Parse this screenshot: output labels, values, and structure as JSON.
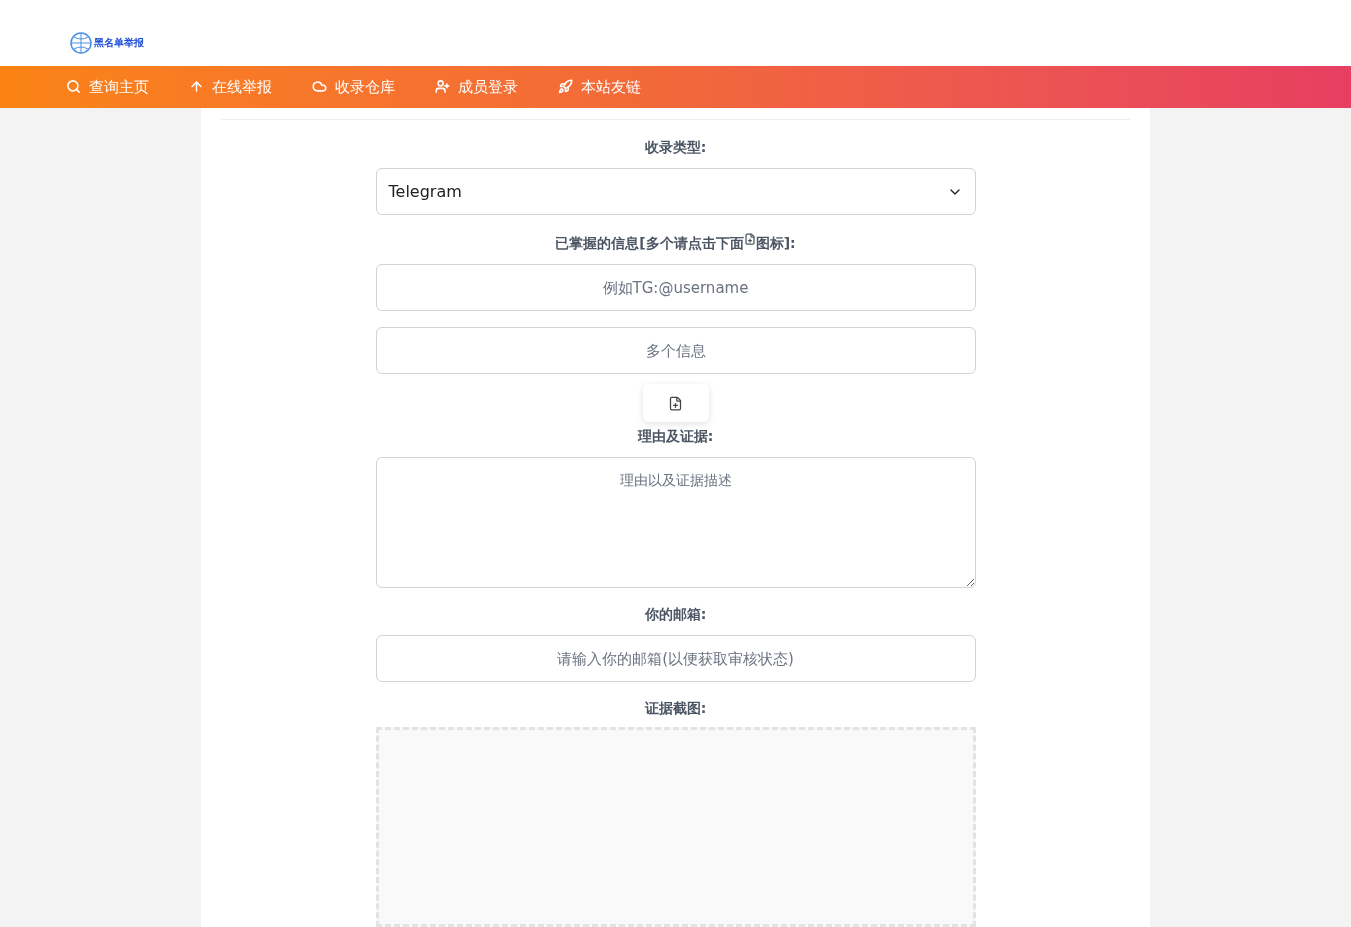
{
  "logo": {
    "text": "黑名单举报"
  },
  "nav": [
    {
      "label": "查询主页"
    },
    {
      "label": "在线举报"
    },
    {
      "label": "收录仓库"
    },
    {
      "label": "成员登录"
    },
    {
      "label": "本站友链"
    }
  ],
  "form": {
    "type_label": "收录类型:",
    "type_value": "Telegram",
    "info_label_before": "已掌握的信息[多个请点击下面",
    "info_label_after": "图标]:",
    "info_placeholder": "例如TG:@username",
    "multi_placeholder": "多个信息",
    "reason_label": "理由及证据:",
    "reason_placeholder": "理由以及证据描述",
    "email_label": "你的邮箱:",
    "email_placeholder": "请输入你的邮箱(以便获取审核状态)",
    "screenshot_label": "证据截图:"
  }
}
